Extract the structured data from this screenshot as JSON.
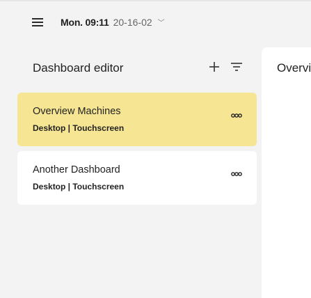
{
  "topbar": {
    "menu_icon": "hamburger-menu-icon",
    "time": "Mon. 09:11",
    "date": "20-16-02",
    "chevron_icon": "chevron-down-icon"
  },
  "panel": {
    "title": "Dashboard editor",
    "add_icon": "plus-icon",
    "filter_icon": "filter-icon"
  },
  "dashboards": [
    {
      "title": "Overview Machines",
      "subtitle": "Desktop | Touchscreen",
      "selected": true
    },
    {
      "title": "Another Dashboard",
      "subtitle": "Desktop | Touchscreen",
      "selected": false
    }
  ],
  "detail": {
    "title": "Overview Machines"
  },
  "colors": {
    "background": "#f3f3f3",
    "card": "#ffffff",
    "selected_card": "#f6e593",
    "text": "#222222"
  }
}
